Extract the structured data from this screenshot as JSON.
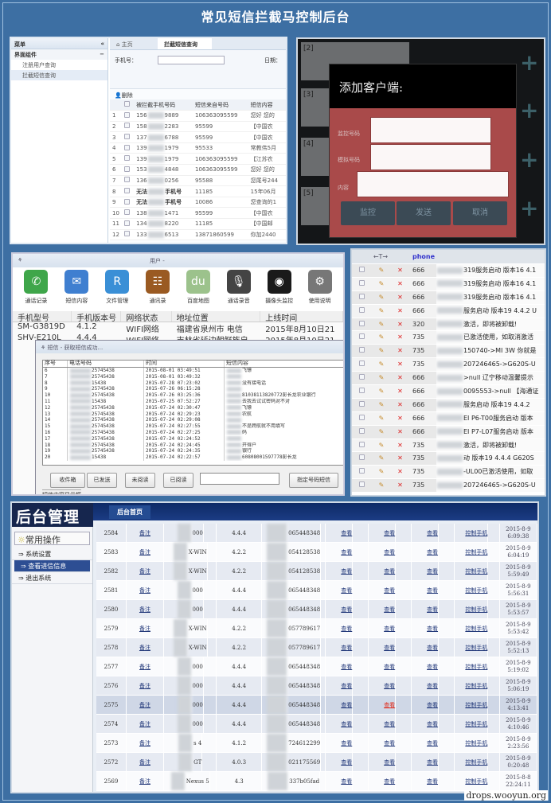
{
  "title": "常见短信拦截马控制后台",
  "watermark": "drops.wooyun.org",
  "panel1": {
    "menu_title": "菜单",
    "collapse": "«",
    "group": "界面组件",
    "group_toggle": "−",
    "items": [
      "注册用户查询",
      "拦截短信查询"
    ],
    "tabs": [
      "主页",
      "拦截短信查询"
    ],
    "phone_label": "手机号：",
    "date_label": "日期：",
    "phone_value": "",
    "delete_label": "删除",
    "headers": [
      "被拦截手机号码",
      "短信来自号码",
      "短信内容"
    ],
    "rows": [
      [
        "1",
        "156",
        "9889",
        "106363095599",
        "您好 您的"
      ],
      [
        "2",
        "158",
        "2283",
        "95599",
        "【中国农"
      ],
      [
        "3",
        "137",
        "6788",
        "95599",
        "【中国农"
      ],
      [
        "4",
        "139",
        "1979",
        "95533",
        "常教伟5月"
      ],
      [
        "5",
        "139",
        "1979",
        "106363095599",
        "【江苏农"
      ],
      [
        "6",
        "153",
        "4848",
        "106363095599",
        "您好 您的"
      ],
      [
        "7",
        "136",
        "0256",
        "95588",
        "您尾号244"
      ],
      [
        "8",
        "无法",
        "手机号",
        "11185",
        "15年06月"
      ],
      [
        "9",
        "无法",
        "手机号",
        "10086",
        "您查询的1"
      ],
      [
        "10",
        "138",
        "1471",
        "95599",
        "【中国农"
      ],
      [
        "11",
        "134",
        "8220",
        "11185",
        "【中国邮"
      ],
      [
        "12",
        "133",
        "6513",
        "13871860599",
        "你加2440"
      ]
    ]
  },
  "panel2": {
    "cards": [
      "[2]",
      "[3]",
      "[4]",
      "[5]"
    ],
    "dialog_title": "添加客户端:",
    "labels": [
      "监控号码",
      "模拟号码",
      "内容"
    ],
    "buttons": [
      "监控",
      "发送",
      "取消"
    ]
  },
  "panel3": {
    "title": "用户 -",
    "tools": [
      {
        "label": "通话记录",
        "icon": "phone-icon",
        "color": "#3fa64a",
        "glyph": "✆"
      },
      {
        "label": "短信内容",
        "icon": "mail-icon",
        "color": "#3f7fd0",
        "glyph": "✉"
      },
      {
        "label": "文件管理",
        "icon": "folder-icon",
        "color": "#3a8fd6",
        "glyph": "R"
      },
      {
        "label": "通讯录",
        "icon": "contacts-icon",
        "color": "#9a5a22",
        "glyph": "☷"
      },
      {
        "label": "百度地图",
        "icon": "map-icon",
        "color": "#9cc28c",
        "glyph": "du"
      },
      {
        "label": "通话录音",
        "icon": "microphone-icon",
        "color": "#444",
        "glyph": "🎙"
      },
      {
        "label": "摄像头监控",
        "icon": "camera-icon",
        "color": "#1a1a1a",
        "glyph": "◉"
      },
      {
        "label": "使用说明",
        "icon": "gear-icon",
        "color": "#777",
        "glyph": "⚙"
      }
    ],
    "headers": [
      "手机型号",
      "手机版本号",
      "网络状态",
      "地址位置",
      "上线时间"
    ],
    "devices": [
      [
        "SM-G3819D",
        "4.1.2",
        "WIFI网络",
        "福建省泉州市 电信",
        "2015年8月10日21"
      ],
      [
        "SHV-E210L",
        "4.4.4",
        "WIFI网络",
        "吉林省延边朝鲜族自",
        "2015年8月10日21"
      ]
    ],
    "sms_window_title": "短信 - 获取短信成功...",
    "sms_headers": [
      "序号",
      "电话号码",
      "时间",
      "短信内容"
    ],
    "sms_rows": [
      [
        "6",
        "25745438",
        "2015-08-01 03:49:51",
        "飞镖"
      ],
      [
        "7",
        "25745438",
        "2015-08-01 03:49:32",
        ""
      ],
      [
        "8",
        "15438",
        "2015-07-28 07:23:02",
        "没有接电话"
      ],
      [
        "9",
        "25745438",
        "2015-07-26 06:15:28",
        ""
      ],
      [
        "10",
        "25745438",
        "2015-07-26 03:25:36",
        "81038113820772彭长龙农业银行"
      ],
      [
        "11",
        "15438",
        "2015-07-25 07:52:27",
        "去我去试试密码对不对"
      ],
      [
        "12",
        "25745438",
        "2015-07-24 02:30:47",
        "飞镖"
      ],
      [
        "13",
        "25745438",
        "2015-07-24 02:29:23",
        "农航"
      ],
      [
        "14",
        "25745438",
        "2015-07-24 02:29:08",
        ""
      ],
      [
        "15",
        "25745438",
        "2015-07-24 02:27:55",
        "不是跨航就不用填写"
      ],
      [
        "16",
        "25745438",
        "2015-07-24 02:27:25",
        "码"
      ],
      [
        "17",
        "25745438",
        "2015-07-24 02:24:52",
        ""
      ],
      [
        "18",
        "25745438",
        "2015-07-24 02:24:45",
        "开得户"
      ],
      [
        "19",
        "25745438",
        "2015-07-24 02:24:35",
        "银行"
      ],
      [
        "20",
        "15438",
        "2015-07-24 02:22:57",
        "60808001597778彭长龙"
      ]
    ],
    "buttons": [
      "收件箱",
      "已发送",
      "未阅读",
      "已阅读",
      "指定号码短信"
    ],
    "number_input": "",
    "fieldset": "短信内容显示框"
  },
  "panel4": {
    "header": "phone",
    "arrows": "←T→",
    "rows": [
      [
        "666",
        "319服务启动 版本16 4.1"
      ],
      [
        "666",
        "319服务启动 版本16 4.1"
      ],
      [
        "666",
        "319服务启动 版本16 4.1"
      ],
      [
        "666",
        "服务启动 版本19 4.4.2 U"
      ],
      [
        "320",
        "激活，即将被卸载!"
      ],
      [
        "735",
        "已激活使用，如取消激活"
      ],
      [
        "735",
        "150740->MI 3W 你就是"
      ],
      [
        "735",
        "207246465->G620S-U"
      ],
      [
        "666",
        ">null 辽宁移动温馨提示"
      ],
      [
        "666",
        "0095553->null 【海通证"
      ],
      [
        "666",
        "服务启动 版本19 4.4.2"
      ],
      [
        "666",
        "EI P6-T00服务启动 版本"
      ],
      [
        "666",
        "EI P7-L07服务启动 版本"
      ],
      [
        "735",
        "激活，即将被卸载!"
      ],
      [
        "735",
        "动 版本19 4.4.4 G620S"
      ],
      [
        "735",
        "-UL00已激活使用，如取"
      ],
      [
        "735",
        "207246465->G620S-U"
      ]
    ]
  },
  "panel5": {
    "logo": "后台管理",
    "tab": "后台首页",
    "section": "常用操作",
    "menu": [
      "系统设置",
      "查看进信信息",
      "退出系统"
    ],
    "note": "备注",
    "view": "查看",
    "control": "控制手机",
    "rows": [
      [
        "2584",
        "000",
        "4.4.4",
        "065448348",
        "2015-8-9",
        "6:09:38",
        false
      ],
      [
        "2583",
        "X-WIN",
        "4.2.2",
        "054128538",
        "2015-8-9",
        "6:04:19",
        false
      ],
      [
        "2582",
        "X-WIN",
        "4.2.2",
        "054128538",
        "2015-8-9",
        "5:59:49",
        false
      ],
      [
        "2581",
        "000",
        "4.4.4",
        "065448348",
        "2015-8-9",
        "5:56:31",
        false
      ],
      [
        "2580",
        "000",
        "4.4.4",
        "065448348",
        "2015-8-9",
        "5:53:57",
        false
      ],
      [
        "2579",
        "X-WIN",
        "4.2.2",
        "057789617",
        "2015-8-9",
        "5:53:42",
        false
      ],
      [
        "2578",
        "X-WIN",
        "4.2.2",
        "057789617",
        "2015-8-9",
        "5:52:13",
        false
      ],
      [
        "2577",
        "000",
        "4.4.4",
        "065448348",
        "2015-8-9",
        "5:19:02",
        false
      ],
      [
        "2576",
        "000",
        "4.4.4",
        "065448348",
        "2015-8-9",
        "5:06:19",
        false
      ],
      [
        "2575",
        "000",
        "4.4.4",
        "065448348",
        "2015-8-9",
        "4:13:41",
        true
      ],
      [
        "2574",
        "000",
        "4.4.4",
        "065448348",
        "2015-8-9",
        "4:10:46",
        false
      ],
      [
        "2573",
        "s 4",
        "4.1.2",
        "724612299",
        "2015-8-9",
        "2:23:56",
        false
      ],
      [
        "2572",
        "GT",
        "4.0.3",
        "021175569",
        "2015-8-9",
        "0:20:48",
        false
      ],
      [
        "2569",
        "Nexus 5",
        "4.3",
        "337b05fad",
        "2015-8-8",
        "22:24:11",
        false
      ]
    ]
  }
}
